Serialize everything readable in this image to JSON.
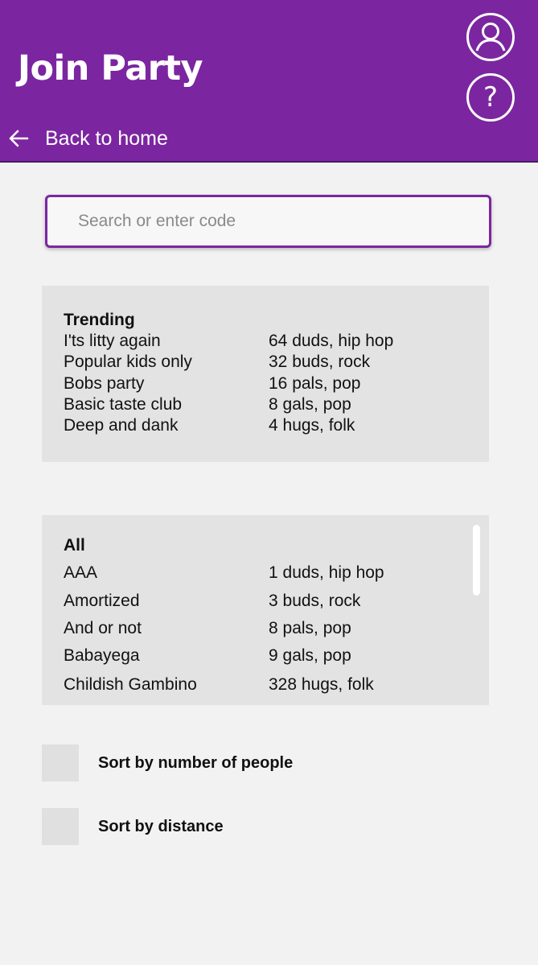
{
  "header": {
    "title": "Join Party",
    "back_label": "Back to home",
    "background_color": "#7b26a0",
    "icons": [
      "profile-icon",
      "help-icon"
    ],
    "help_symbol": "?"
  },
  "search": {
    "placeholder": "Search or enter code",
    "value": ""
  },
  "trending": {
    "title": "Trending",
    "items": [
      {
        "name": "I'ts litty again",
        "info": "64 duds, hip hop"
      },
      {
        "name": "Popular kids only",
        "info": "32 buds, rock"
      },
      {
        "name": "Bobs party",
        "info": "16 pals, pop"
      },
      {
        "name": "Basic taste club",
        "info": "8 gals, pop"
      },
      {
        "name": "Deep and dank",
        "info": "4 hugs, folk"
      }
    ]
  },
  "all": {
    "title": "All",
    "items": [
      {
        "name": "AAA",
        "info": "1 duds, hip hop"
      },
      {
        "name": "Amortized",
        "info": "3 buds, rock"
      },
      {
        "name": "And or not",
        "info": "8 pals, pop"
      },
      {
        "name": "Babayega",
        "info": "9 gals, pop"
      },
      {
        "name": "Childish Gambino",
        "info": "328 hugs, folk"
      }
    ]
  },
  "sort": {
    "by_people": {
      "label": "Sort by number of people",
      "checked": false
    },
    "by_distance": {
      "label": "Sort by distance",
      "checked": false
    }
  }
}
